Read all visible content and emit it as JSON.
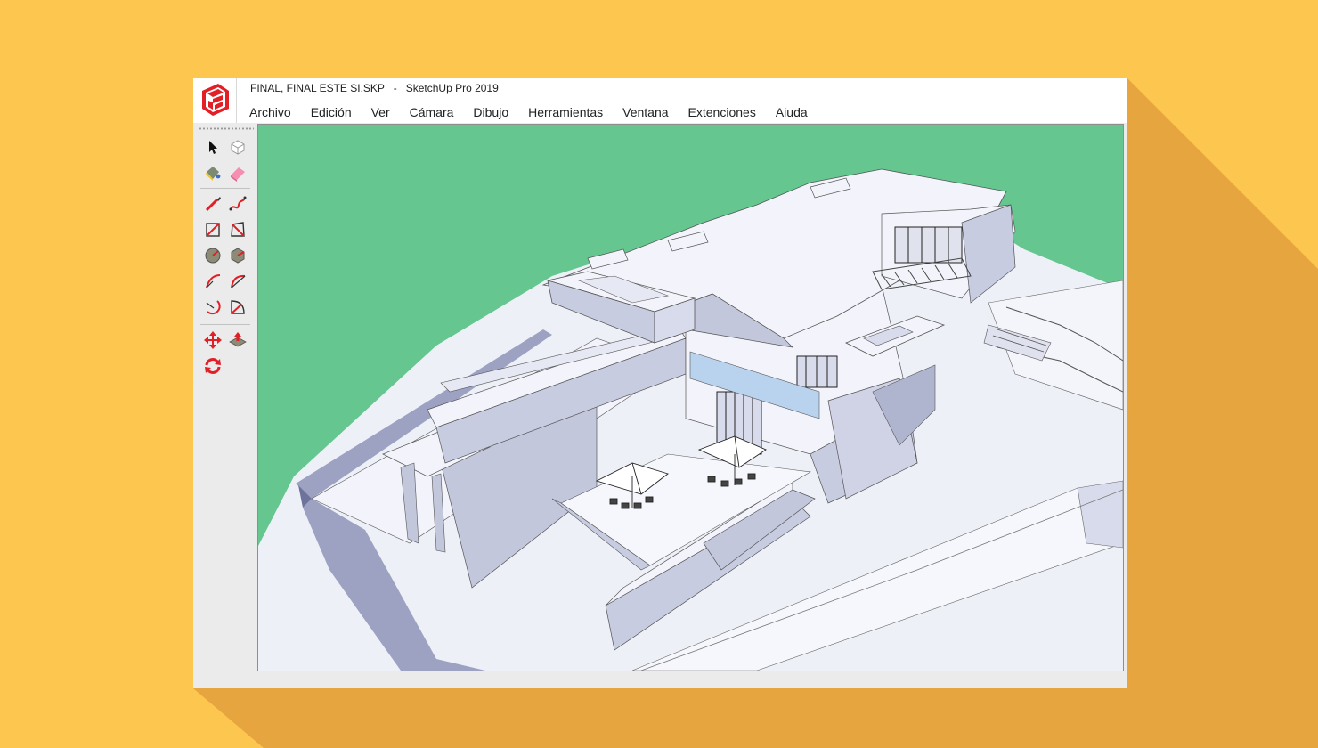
{
  "window": {
    "title": "FINAL, FINAL ESTE SI.SKP   -   SketchUp Pro 2019"
  },
  "menu": [
    {
      "label": "Archivo"
    },
    {
      "label": "Edición"
    },
    {
      "label": "Ver"
    },
    {
      "label": "Cámara"
    },
    {
      "label": "Dibujo"
    },
    {
      "label": "Herramientas"
    },
    {
      "label": "Ventana"
    },
    {
      "label": "Extenciones"
    },
    {
      "label": "Aiuda"
    }
  ],
  "toolbar": {
    "tools": [
      {
        "name": "select-tool",
        "icon": "arrow-cursor-icon"
      },
      {
        "name": "make-component-tool",
        "icon": "cube-icon"
      },
      {
        "name": "paint-bucket-tool",
        "icon": "paint-bucket-icon"
      },
      {
        "name": "eraser-tool",
        "icon": "eraser-icon"
      },
      {
        "name": "line-tool",
        "icon": "pencil-icon"
      },
      {
        "name": "freehand-tool",
        "icon": "freehand-icon"
      },
      {
        "name": "rectangle-tool",
        "icon": "rectangle-icon"
      },
      {
        "name": "rotated-rectangle-tool",
        "icon": "rotated-rectangle-icon"
      },
      {
        "name": "circle-tool",
        "icon": "circle-icon"
      },
      {
        "name": "polygon-tool",
        "icon": "polygon-icon"
      },
      {
        "name": "arc-tool",
        "icon": "arc-icon"
      },
      {
        "name": "two-point-arc-tool",
        "icon": "two-point-arc-icon"
      },
      {
        "name": "three-point-arc-tool",
        "icon": "three-point-arc-icon"
      },
      {
        "name": "pie-tool",
        "icon": "pie-icon"
      },
      {
        "name": "move-tool",
        "icon": "move-icon"
      },
      {
        "name": "push-pull-tool",
        "icon": "push-pull-icon"
      },
      {
        "name": "rotate-tool",
        "icon": "rotate-icon"
      }
    ]
  },
  "colors": {
    "background": "#fdc64f",
    "shadow": "#d99a3a",
    "sky": "#66c68f",
    "model_white": "#f3f4fb",
    "model_shade": "#c8cce0",
    "model_dark": "#8f95b8",
    "accent_red": "#e21f26"
  }
}
